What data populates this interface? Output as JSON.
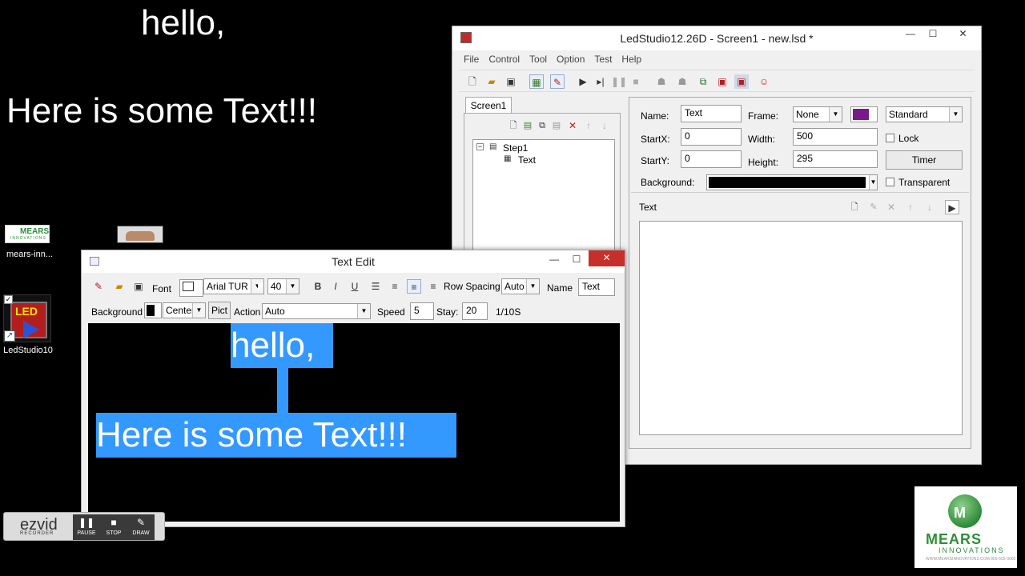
{
  "desktop": {
    "led_line1": "hello,",
    "led_line2": "Here is some Text!!!",
    "icon_mears_label": "mears-inn...",
    "icon_mears_logo_text": "MEARS",
    "icon_mears_logo_sub": "INNOVATIONS",
    "icon_ledstudio_label": "LedStudio10",
    "icon_ledstudio_tile_text": "LED"
  },
  "main_window": {
    "title": "LedStudio12.26D - Screen1 - new.lsd *",
    "menu": [
      "File",
      "Control",
      "Tool",
      "Option",
      "Test",
      "Help"
    ],
    "screen_tab": "Screen1",
    "tree": {
      "root": "Step1",
      "child": "Text"
    },
    "props": {
      "name_label": "Name:",
      "name_value": "Text",
      "frame_label": "Frame:",
      "frame_value": "None",
      "style_value": "Standard",
      "startx_label": "StartX:",
      "startx_value": "0",
      "width_label": "Width:",
      "width_value": "500",
      "lock_label": "Lock",
      "starty_label": "StartY:",
      "starty_value": "0",
      "height_label": "Height:",
      "height_value": "295",
      "timer_label": "Timer",
      "background_label": "Background:",
      "transparent_label": "Transparent",
      "text_section_label": "Text"
    },
    "frame_color": "#7a1a8a"
  },
  "text_edit": {
    "title": "Text Edit",
    "font_label": "Font",
    "font_value": "Arial TUR",
    "size_value": "40",
    "row_spacing_label": "Row Spacing",
    "row_spacing_value": "Auto",
    "name_label": "Name",
    "name_value": "Text",
    "background_label": "Background",
    "align_value": "Center",
    "pict_label": "Pict",
    "action_label": "Action",
    "action_value": "Auto",
    "speed_label": "Speed",
    "speed_value": "5",
    "stay_label": "Stay:",
    "stay_value": "20",
    "unit_label": "1/10S",
    "content_line1": "hello,",
    "content_line2": "Here is some Text!!!",
    "selection_color": "#3399ff"
  },
  "ezvid": {
    "brand": "ezvid",
    "sub": "RECORDER",
    "pause": "PAUSE",
    "stop": "STOP",
    "draw": "DRAW"
  },
  "logo": {
    "mark": "M",
    "name": "MEARS",
    "sub": "INNOVATIONS",
    "tiny": "WWW.MEARSINNOVATIONS.COM 859-555-0000"
  }
}
